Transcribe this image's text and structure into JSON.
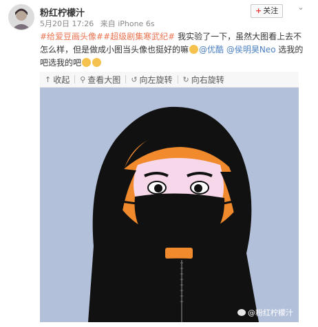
{
  "post": {
    "username": "粉红柠檬汁",
    "time": "5月20日 17:26",
    "source": "来自 iPhone 6s",
    "follow_label": "关注",
    "text_parts": {
      "tag1": "#给爱豆画头像#",
      "tag2": "#超级剧集寒武纪#",
      "body1": " 我实验了一下，虽然大图看上去不怎么样，但是做成小图当头像也挺好的嘛",
      "mention1": "@优酷",
      "mention2": "@侯明昊Neo",
      "body2": " 选我的吧选我的吧"
    }
  },
  "toolbar": {
    "collapse": "收起",
    "view_large": "查看大图",
    "rotate_left": "向左旋转",
    "rotate_right": "向右旋转"
  },
  "image": {
    "watermark": "@粉红柠檬汁"
  },
  "colors": {
    "accent": "#eb7350",
    "link": "#4a7fc1",
    "follow_plus": "#e4393c",
    "image_bg": "#a9b7d3",
    "orange": "#f08a2c"
  }
}
